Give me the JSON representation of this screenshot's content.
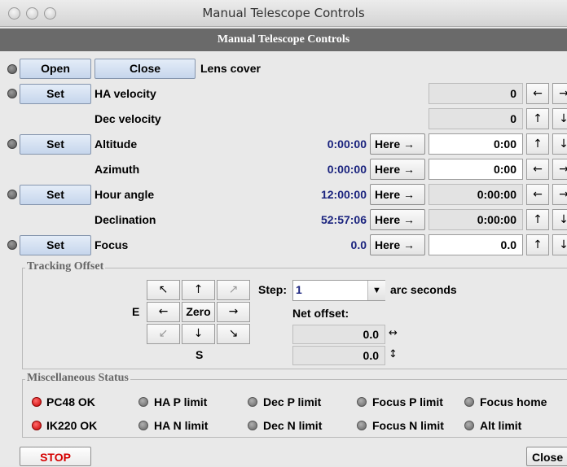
{
  "window": {
    "title": "Manual Telescope Controls"
  },
  "header": {
    "title": "Manual Telescope Controls"
  },
  "lens": {
    "open": "Open",
    "close": "Close",
    "label": "Lens cover"
  },
  "rows": {
    "ha_velocity": {
      "btn": "Set",
      "label": "HA velocity",
      "field": "0",
      "a1": "←",
      "a2": "→"
    },
    "dec_velocity": {
      "label": "Dec velocity",
      "field": "0",
      "a1": "↑",
      "a2": "↓"
    },
    "altitude": {
      "btn": "Set",
      "label": "Altitude",
      "value": "0:00:00",
      "here": "Here →",
      "field": "0:00",
      "a1": "↑",
      "a2": "↓"
    },
    "azimuth": {
      "label": "Azimuth",
      "value": "0:00:00",
      "here": "Here →",
      "field": "0:00",
      "a1": "←",
      "a2": "→"
    },
    "hour_angle": {
      "btn": "Set",
      "label": "Hour angle",
      "value": "12:00:00",
      "here": "Here →",
      "field": "0:00:00",
      "a1": "←",
      "a2": "→"
    },
    "declination": {
      "label": "Declination",
      "value": "52:57:06",
      "here": "Here →",
      "field": "0:00:00",
      "a1": "↑",
      "a2": "↓"
    },
    "focus": {
      "btn": "Set",
      "label": "Focus",
      "value": "0.0",
      "here": "Here →",
      "field": "0.0",
      "a1": "↑",
      "a2": "↓"
    }
  },
  "tracking": {
    "title": "Tracking Offset",
    "pad": {
      "nw": "↖",
      "n": "↑",
      "ne": "↗",
      "w": "←",
      "zero": "Zero",
      "e": "→",
      "sw": "↙",
      "s": "↓",
      "se": "↘"
    },
    "east_label": "E",
    "south_label": "S",
    "step_label": "Step:",
    "step_value": "1",
    "step_unit": "arc seconds",
    "net_label": "Net offset:",
    "net_x": "0.0",
    "net_y": "0.0",
    "net_x_icon": "↔",
    "net_y_icon": "↕"
  },
  "misc": {
    "title": "Miscellaneous Status",
    "row1": [
      "PC48 OK",
      "HA P limit",
      "Dec P limit",
      "Focus P limit",
      "Focus home"
    ],
    "row2": [
      "IK220 OK",
      "HA N limit",
      "Dec N limit",
      "Focus N limit",
      "Alt limit"
    ]
  },
  "footer": {
    "stop": "STOP",
    "close": "Close"
  }
}
